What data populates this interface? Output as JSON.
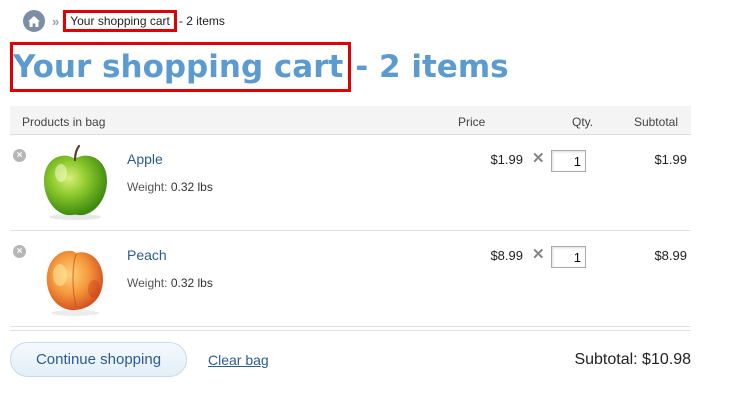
{
  "breadcrumb": {
    "home_icon": "home-icon",
    "separator": "»",
    "current": "Your shopping cart",
    "rest": "- 2 items"
  },
  "title": {
    "main": "Your shopping cart",
    "rest": "- 2 items",
    "color": "#5b9bcf"
  },
  "table": {
    "headers": {
      "products": "Products in bag",
      "price": "Price",
      "qty": "Qty.",
      "subtotal": "Subtotal"
    },
    "rows": [
      {
        "name": "Apple",
        "weight_label": "Weight:",
        "weight": "0.32 lbs",
        "price": "$1.99",
        "times": "✕",
        "qty": "1",
        "subtotal": "$1.99",
        "image": "green-apple"
      },
      {
        "name": "Peach",
        "weight_label": "Weight:",
        "weight": "0.32 lbs",
        "price": "$8.99",
        "times": "✕",
        "qty": "1",
        "subtotal": "$8.99",
        "image": "peach"
      }
    ]
  },
  "footer": {
    "continue_label": "Continue shopping",
    "clear_label": "Clear bag",
    "subtotal": "Subtotal: $10.98"
  },
  "colors": {
    "link": "#2c5d8f",
    "highlight_box": "#e00000"
  }
}
